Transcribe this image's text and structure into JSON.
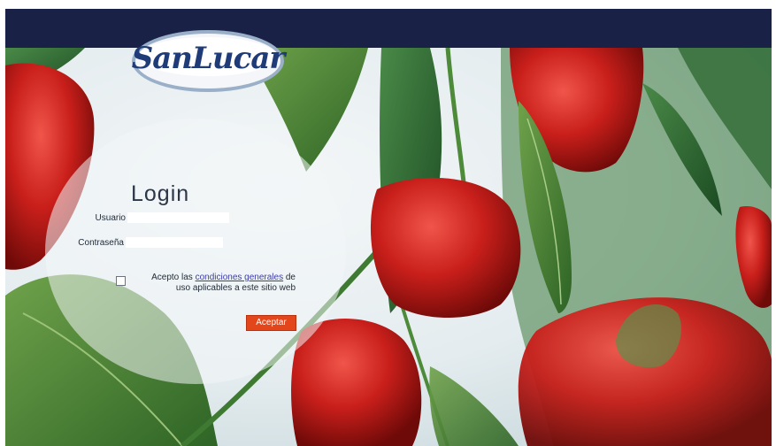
{
  "brand": {
    "logo_text": "SanLucar"
  },
  "login": {
    "title": "Login",
    "user_label": "Usuario",
    "password_label": "Contraseña",
    "user_value": "",
    "password_value": "",
    "terms_prefix": "Acepto las",
    "terms_link": "condiciones generales",
    "terms_suffix": "de uso aplicables a este sitio web",
    "terms_checked": false,
    "accept_label": "Aceptar"
  },
  "colors": {
    "topbar": "#1a2147",
    "accent_button": "#e2461a",
    "logo_blue": "#1f3c78"
  }
}
